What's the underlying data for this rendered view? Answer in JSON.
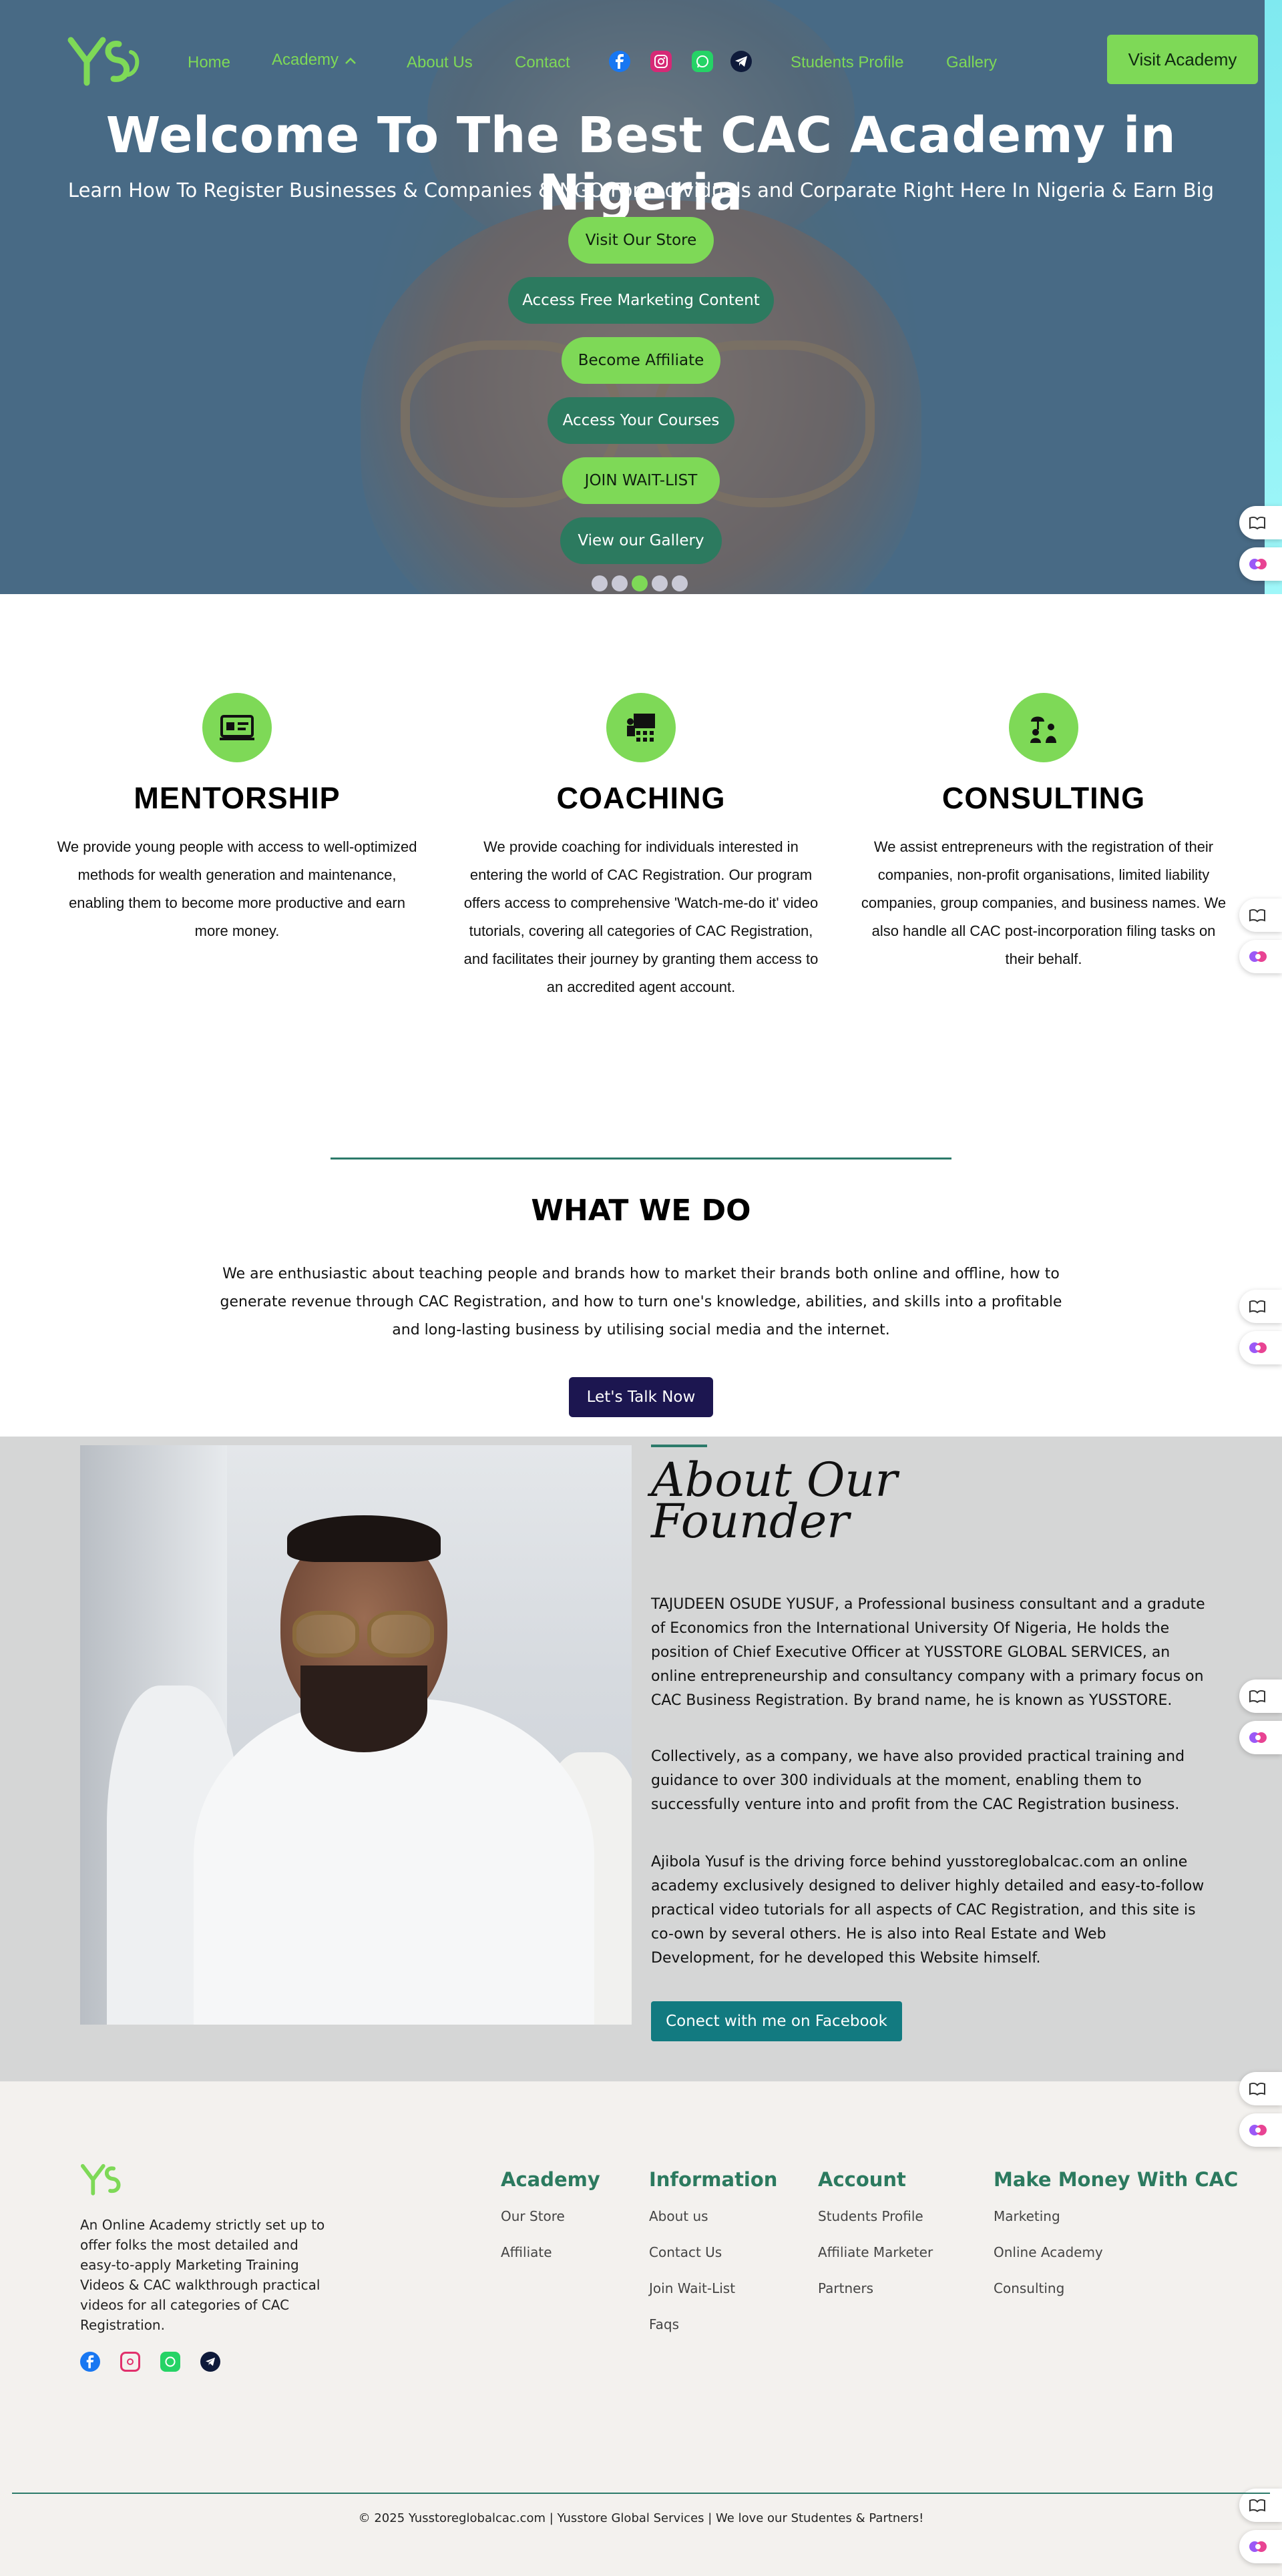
{
  "nav": {
    "items": [
      "Home",
      "Academy",
      "About Us",
      "Contact",
      "Students Profile",
      "Gallery"
    ],
    "visit_button": "Visit Academy",
    "brand_color": "#7ed957"
  },
  "hero": {
    "title": "Welcome To The Best CAC Academy in Nigeria",
    "subtitle": "Learn How To Register Businesses & Companies & NGO For Individuals and Corparate Right Here In Nigeria & Earn Big",
    "buttons": [
      "Visit Our Store",
      "Access Free Marketing Content",
      "Become Affiliate",
      "Access Your Courses",
      "JOIN WAIT-LIST",
      "View our Gallery"
    ]
  },
  "services": [
    {
      "title": "MENTORSHIP",
      "text": "We provide young people with access to well-optimized methods for wealth generation and maintenance, enabling them to become more productive and earn more money."
    },
    {
      "title": "COACHING",
      "text": "We provide coaching for individuals interested in entering the world of CAC Registration. Our program offers access to comprehensive 'Watch-me-do it' video tutorials, covering all categories of CAC Registration, and facilitates their journey by granting them access to an accredited agent account."
    },
    {
      "title": "CONSULTING",
      "text": "We assist entrepreneurs with the registration of their companies, non-profit organisations, limited liability companies, group companies, and business names. We also handle all CAC post-incorporation filing tasks on their behalf."
    }
  ],
  "what_we_do": {
    "title": "WHAT WE DO",
    "text": "We are enthusiastic about teaching people and brands how to market their brands both online and offline, how to generate revenue through CAC Registration, and how to turn one's knowledge, abilities, and skills into a profitable and long-lasting business by utilising social media and the internet.",
    "button": "Let's Talk Now"
  },
  "founder": {
    "title_line1": "About Our",
    "title_line2": "Founder",
    "p1": "TAJUDEEN OSUDE YUSUF, a Professional business consultant and a gradute of Economics fron the International University Of Nigeria, He holds the position of Chief Executive Officer at YUSSTORE GLOBAL SERVICES, an online entrepreneurship and consultancy company with a primary focus on CAC Business Registration. By brand name, he is known as YUSSTORE.",
    "p2": "Collectively, as a company, we have also provided practical training and guidance to over 300 individuals at the moment, enabling them to successfully venture into and profit from the CAC Registration business.",
    "p3": "Ajibola Yusuf is the driving force behind yusstoreglobalcac.com an online academy exclusively designed to deliver highly detailed and easy-to-follow practical video tutorials for all aspects of CAC Registration, and this site is co-own by several others. He is also into Real Estate and Web Development, for he developed this Website himself.",
    "button": "Conect with me on Facebook"
  },
  "footer": {
    "about": "An Online Academy strictly set up to offer folks the most detailed and easy-to-apply Marketing Training Videos & CAC walkthrough practical videos for all categories of CAC Registration.",
    "columns": [
      {
        "heading": "Academy",
        "links": [
          "Our Store",
          "Affiliate"
        ]
      },
      {
        "heading": "Information",
        "links": [
          "About us",
          "Contact Us",
          "Join Wait-List",
          "Faqs"
        ]
      },
      {
        "heading": "Account",
        "links": [
          "Students Profile",
          "Affiliate Marketer",
          "Partners"
        ]
      },
      {
        "heading": "Make Money With CAC",
        "links": [
          "Marketing",
          "Online Academy",
          "Consulting"
        ]
      }
    ],
    "copyright": "© 2025 Yusstoreglobalcac.com | Yusstore Global Services | We love our Studentes & Partners!"
  },
  "icons": [
    "facebook-icon",
    "instagram-icon",
    "whatsapp-icon",
    "telegram-icon",
    "id-card-icon",
    "presentation-icon",
    "consulting-icon",
    "book-icon",
    "brain-icon"
  ]
}
